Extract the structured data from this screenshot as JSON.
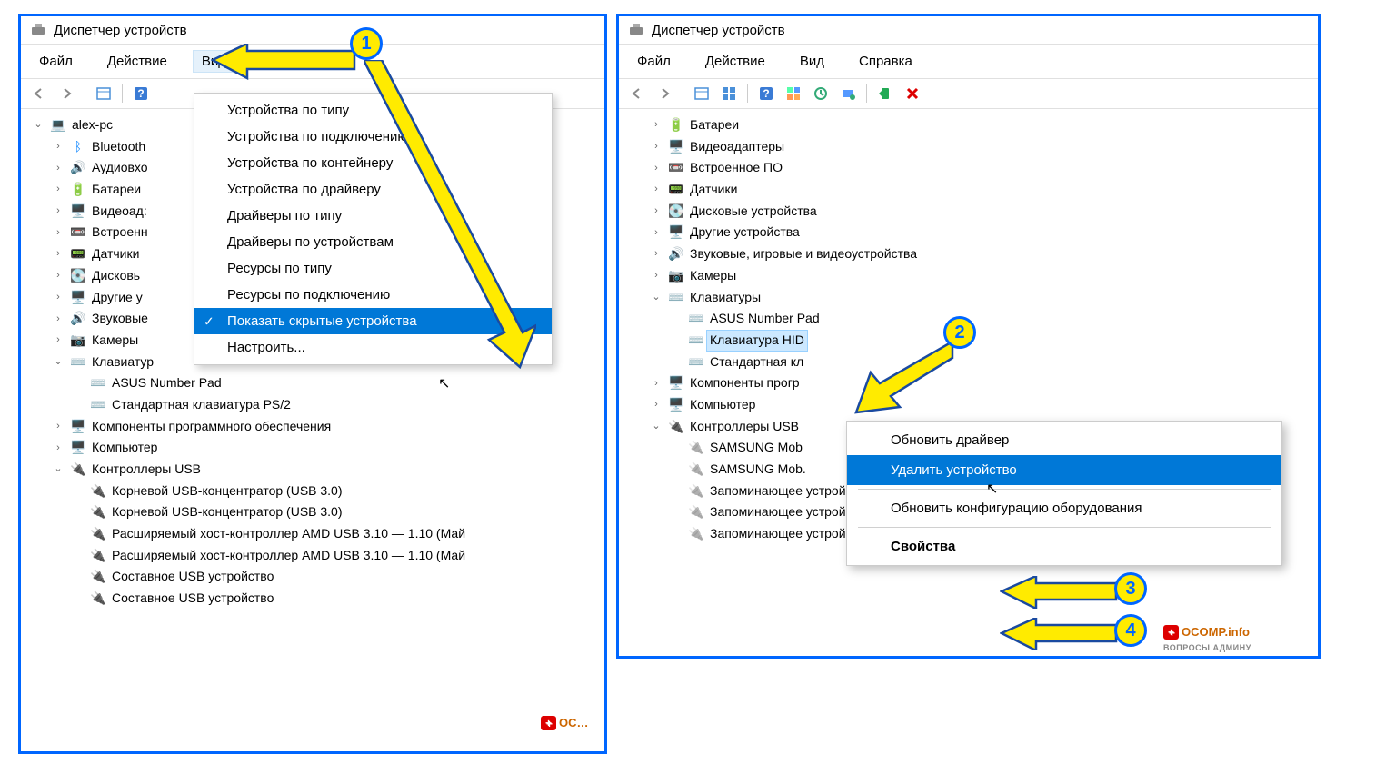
{
  "window_title": "Диспетчер устройств",
  "menu": {
    "file": "Файл",
    "action": "Действие",
    "view": "Вид",
    "help": "Справка"
  },
  "view_dropdown": {
    "by_type": "Устройства по типу",
    "by_connection": "Устройства по подключению",
    "by_container": "Устройства по контейнеру",
    "by_driver": "Устройства по драйверу",
    "drivers_by_type": "Драйверы по типу",
    "drivers_by_device": "Драйверы по устройствам",
    "resources_by_type": "Ресурсы по типу",
    "resources_by_connection": "Ресурсы по подключению",
    "show_hidden": "Показать скрытые устройства",
    "customize": "Настроить..."
  },
  "ctx_menu": {
    "update_driver": "Обновить драйвер",
    "uninstall": "Удалить устройство",
    "scan": "Обновить конфигурацию оборудования",
    "properties": "Свойства"
  },
  "left_tree": {
    "root": "alex-pc",
    "bluetooth": "Bluetooth",
    "audio_in": "Аудиовхо",
    "batteries": "Батареи",
    "video": "Видеоад:",
    "firmware": "Встроенн",
    "sensors": "Датчики",
    "disk": "Дисковь",
    "other": "Другие у",
    "sound": "Звуковые",
    "cameras": "Камеры",
    "keyboards": "Клавиатур",
    "asus_pad": "ASUS Number Pad",
    "ps2": "Стандартная клавиатура PS/2",
    "sw_components": "Компоненты программного обеспечения",
    "computer": "Компьютер",
    "usb_controllers": "Контроллеры USB",
    "usb_hub1": "Корневой USB-концентратор (USB 3.0)",
    "usb_hub2": "Корневой USB-концентратор (USB 3.0)",
    "amd_host1": "Расширяемый хост-контроллер AMD USB 3.10 — 1.10 (Май",
    "amd_host2": "Расширяемый хост-контроллер AMD USB 3.10 — 1.10 (Май",
    "composite1": "Составное USB устройство",
    "composite2": "Составное USB устройство"
  },
  "right_tree": {
    "batteries": "Батареи",
    "video": "Видеоадаптеры",
    "firmware": "Встроенное ПО",
    "sensors": "Датчики",
    "disk": "Дисковые устройства",
    "other": "Другие устройства",
    "sound": "Звуковые, игровые и видеоустройства",
    "cameras": "Камеры",
    "keyboards": "Клавиатуры",
    "asus_pad": "ASUS Number Pad",
    "hid_kbd": "Клавиатура HID",
    "std_kbd": "Стандартная кл",
    "sw_components": "Компоненты прогр",
    "computer": "Компьютер",
    "usb_controllers": "Контроллеры USB",
    "samsung1": "SAMSUNG Mob",
    "samsung2": "SAMSUNG Mob.",
    "storage1": "Запоминающее устройство для USB",
    "storage2": "Запоминающее устройство для USB",
    "storage3": "Запоминающее устройство для USB"
  },
  "badges": {
    "b1": "1",
    "b2": "2",
    "b3": "3",
    "b4": "4"
  },
  "watermark": {
    "plus": "+",
    "text": "OCOMP.info",
    "sub": "ВОПРОСЫ АДМИНУ"
  }
}
